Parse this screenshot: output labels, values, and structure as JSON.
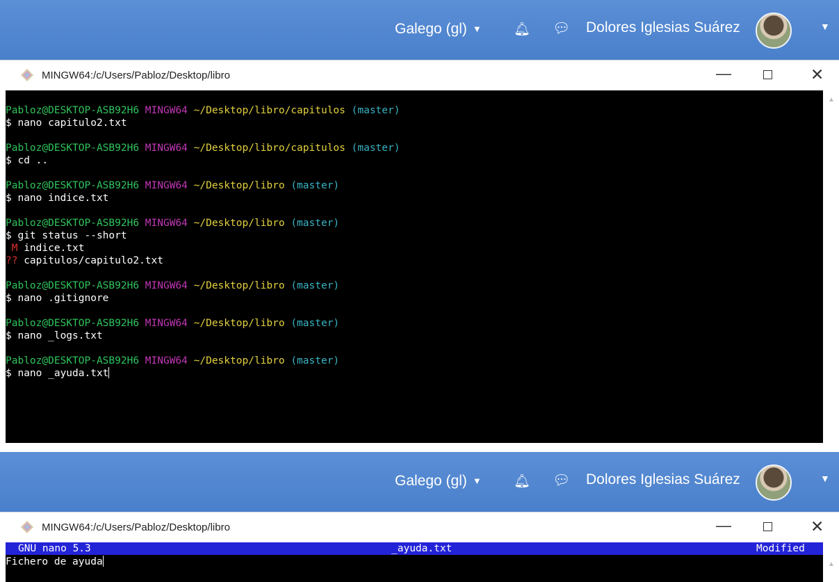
{
  "topbar": {
    "language": "Galego (gl)",
    "user_name": "Dolores Iglesias Suárez"
  },
  "window": {
    "title": "MINGW64:/c/Users/Pabloz/Desktop/libro"
  },
  "terminal": {
    "blocks": [
      {
        "user": "Pabloz@DESKTOP-ASB92H6",
        "env": "MINGW64",
        "path": "~/Desktop/libro/capitulos",
        "branch": "(master)",
        "command": "$ nano capitulo2.txt"
      },
      {
        "user": "Pabloz@DESKTOP-ASB92H6",
        "env": "MINGW64",
        "path": "~/Desktop/libro/capitulos",
        "branch": "(master)",
        "command": "$ cd .."
      },
      {
        "user": "Pabloz@DESKTOP-ASB92H6",
        "env": "MINGW64",
        "path": "~/Desktop/libro",
        "branch": "(master)",
        "command": "$ nano indice.txt"
      },
      {
        "user": "Pabloz@DESKTOP-ASB92H6",
        "env": "MINGW64",
        "path": "~/Desktop/libro",
        "branch": "(master)",
        "command": "$ git status --short",
        "output": [
          {
            "flag": " M",
            "file": " indice.txt"
          },
          {
            "flag": "??",
            "file": " capitulos/capitulo2.txt"
          }
        ]
      },
      {
        "user": "Pabloz@DESKTOP-ASB92H6",
        "env": "MINGW64",
        "path": "~/Desktop/libro",
        "branch": "(master)",
        "command": "$ nano .gitignore"
      },
      {
        "user": "Pabloz@DESKTOP-ASB92H6",
        "env": "MINGW64",
        "path": "~/Desktop/libro",
        "branch": "(master)",
        "command": "$ nano _logs.txt"
      },
      {
        "user": "Pabloz@DESKTOP-ASB92H6",
        "env": "MINGW64",
        "path": "~/Desktop/libro",
        "branch": "(master)",
        "command": "$ nano _ayuda.txt"
      }
    ]
  },
  "nano": {
    "version": "GNU nano 5.3",
    "filename": "_ayuda.txt",
    "status": "Modified",
    "content": "Fichero de ayuda"
  },
  "colors": {
    "header_bg": "#4a7fcb",
    "user": "#2fc45c",
    "env": "#c037b5",
    "path": "#e3d13f",
    "branch": "#38b4c4",
    "nano_header": "#2323d8"
  },
  "icons": [
    "bell-icon",
    "chat-icon",
    "avatar",
    "git-bash-icon",
    "minimize-icon",
    "maximize-icon",
    "close-icon"
  ]
}
